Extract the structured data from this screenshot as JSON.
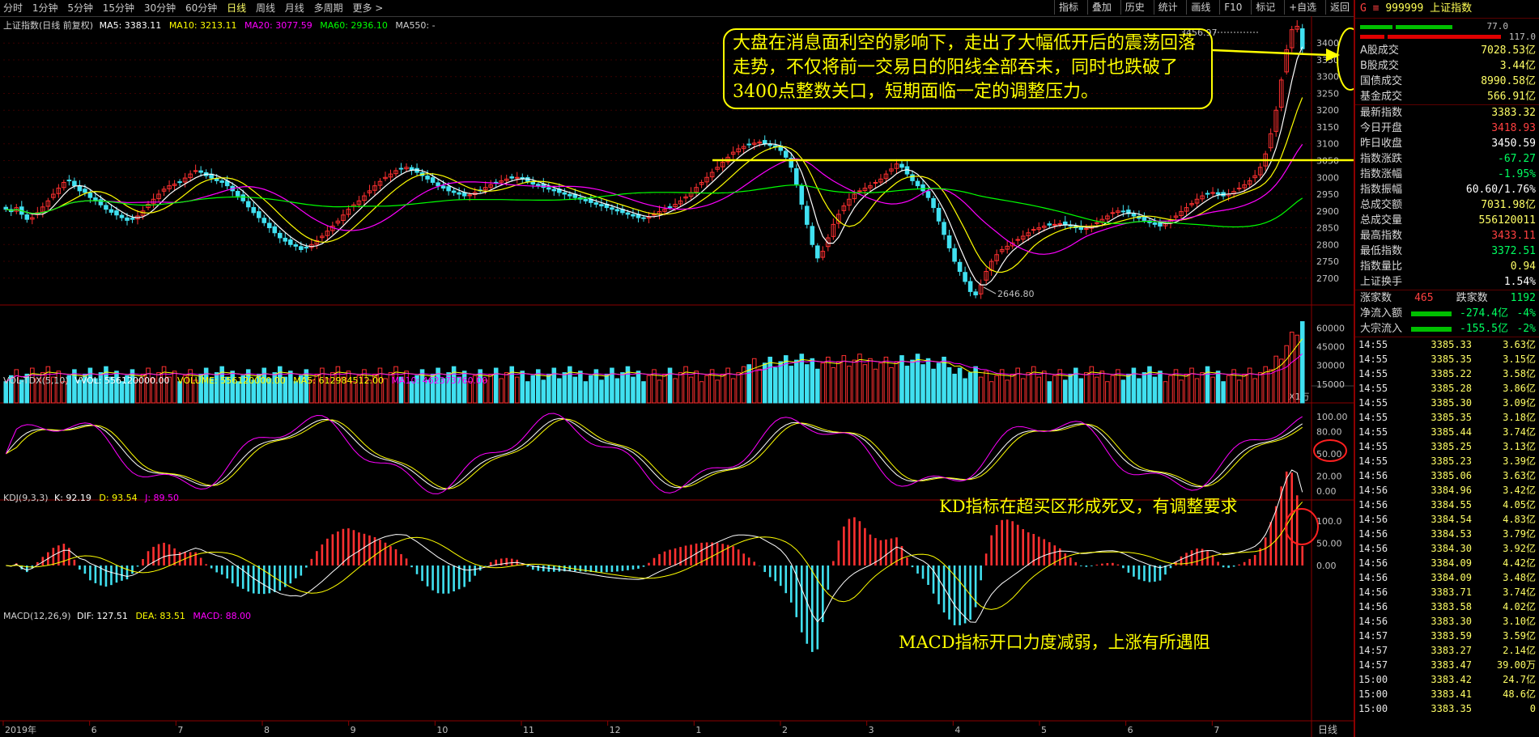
{
  "topbar": {
    "periods": [
      "分时",
      "1分钟",
      "5分钟",
      "15分钟",
      "30分钟",
      "60分钟",
      "日线",
      "周线",
      "月线",
      "多周期",
      "更多 >"
    ],
    "active_period": "日线",
    "right_buttons": [
      "指标",
      "叠加",
      "历史",
      "统计",
      "画线",
      "F10",
      "标记",
      "+自选",
      "返回"
    ]
  },
  "main_chart": {
    "title": "上证指数(日线 前复权)",
    "ma5": "MA5: 3383.11",
    "ma10": "MA10: 3213.11",
    "ma20": "MA20: 3077.59",
    "ma60": "MA60: 2936.10",
    "ma550": "MA550: -",
    "high_label": "3456.97",
    "low_label": "2646.80",
    "y_ticks": [
      "3400",
      "3350",
      "3300",
      "3250",
      "3200",
      "3150",
      "3100",
      "3050",
      "3000",
      "2950",
      "2900",
      "2850",
      "2800",
      "2750",
      "2700"
    ]
  },
  "volume_panel": {
    "title": "VOL-TDX(5,10)",
    "vvol": "VVOL: 556120000.00",
    "volume": "VOLUME: 556120000.00",
    "ma5": "MA5: 612984512.00",
    "ma10": "MA10: 462373760.00",
    "y_ticks": [
      "60000",
      "45000",
      "30000",
      "15000"
    ],
    "unit": "X1万"
  },
  "kdj_panel": {
    "title": "KDJ(9,3,3)",
    "k": "K: 92.19",
    "d": "D: 93.54",
    "j": "J: 89.50",
    "y_ticks": [
      "100.00",
      "80.00",
      "50.00",
      "20.00",
      "0.00"
    ]
  },
  "macd_panel": {
    "title": "MACD(12,26,9)",
    "dif": "DIF: 127.51",
    "dea": "DEA: 83.51",
    "macd": "MACD: 88.00",
    "y_ticks": [
      "100.0",
      "50.00",
      "0.00"
    ]
  },
  "x_axis": {
    "labels": [
      "2019年",
      "6",
      "7",
      "8",
      "9",
      "10",
      "11",
      "12",
      "1",
      "2",
      "3",
      "4",
      "5",
      "6",
      "7"
    ],
    "period_tag": "日线"
  },
  "annotations": {
    "main": "大盘在消息面利空的影响下，走出了大幅低开后的震荡回落走势，不仅将前一交易日的阳线全部吞末，同时也跌破了3400点整数关口，短期面临一定的调整压力。",
    "kd": "KD指标在超买区形成死叉，有调整要求",
    "macd": "MACD指标开口力度减弱，上涨有所遇阻"
  },
  "colors": {
    "up": "#ff3030",
    "down": "#40e0f0",
    "ma5": "#ffffff",
    "ma10": "#ffff00",
    "ma20": "#ff00ff",
    "ma60": "#00ff00",
    "annotation": "#ffff00"
  },
  "sidebar": {
    "header_code": "999999 上证指数",
    "header_prefix": "G ≡",
    "bar1_value": "77.0",
    "bar2_value": "117.0",
    "stats": [
      {
        "label": "A股成交",
        "value": "7028.53亿",
        "color": "#ffff66"
      },
      {
        "label": "B股成交",
        "value": "3.44亿",
        "color": "#ffff66"
      },
      {
        "label": "国债成交",
        "value": "8990.58亿",
        "color": "#ffff66"
      },
      {
        "label": "基金成交",
        "value": "566.91亿",
        "color": "#ffff66"
      }
    ],
    "quote": [
      {
        "label": "最新指数",
        "value": "3383.32",
        "color": "#ffff66"
      },
      {
        "label": "今日开盘",
        "value": "3418.93",
        "color": "#ff4040"
      },
      {
        "label": "昨日收盘",
        "value": "3450.59",
        "color": "#ffffff"
      },
      {
        "label": "指数涨跌",
        "value": "-67.27",
        "color": "#00ff60"
      },
      {
        "label": "指数涨幅",
        "value": "-1.95%",
        "color": "#00ff60"
      },
      {
        "label": "指数振幅",
        "value": "60.60/1.76%",
        "color": "#ffffff"
      },
      {
        "label": "总成交额",
        "value": "7031.98亿",
        "color": "#ffff66"
      },
      {
        "label": "总成交量",
        "value": "556120011",
        "color": "#ffff66"
      },
      {
        "label": "最高指数",
        "value": "3433.11",
        "color": "#ff4040"
      },
      {
        "label": "最低指数",
        "value": "3372.51",
        "color": "#00ff60"
      },
      {
        "label": "指数量比",
        "value": "0.94",
        "color": "#ffff66"
      },
      {
        "label": "上证换手",
        "value": "1.54%",
        "color": "#ffffff"
      }
    ],
    "breadth": {
      "up_label": "涨家数",
      "up_value": "465",
      "down_label": "跌家数",
      "down_value": "1192"
    },
    "flows": [
      {
        "label": "净流入额",
        "value": "-274.4亿",
        "pct": "-4%"
      },
      {
        "label": "大宗流入",
        "value": "-155.5亿",
        "pct": "-2%"
      }
    ],
    "trades": [
      {
        "t": "14:55",
        "p": "3385.33",
        "v": "3.63亿"
      },
      {
        "t": "14:55",
        "p": "3385.35",
        "v": "3.15亿"
      },
      {
        "t": "14:55",
        "p": "3385.22",
        "v": "3.58亿"
      },
      {
        "t": "14:55",
        "p": "3385.28",
        "v": "3.86亿"
      },
      {
        "t": "14:55",
        "p": "3385.30",
        "v": "3.09亿"
      },
      {
        "t": "14:55",
        "p": "3385.35",
        "v": "3.18亿"
      },
      {
        "t": "14:55",
        "p": "3385.44",
        "v": "3.74亿"
      },
      {
        "t": "14:55",
        "p": "3385.25",
        "v": "3.13亿"
      },
      {
        "t": "14:55",
        "p": "3385.23",
        "v": "3.39亿"
      },
      {
        "t": "14:56",
        "p": "3385.06",
        "v": "3.63亿"
      },
      {
        "t": "14:56",
        "p": "3384.96",
        "v": "3.42亿"
      },
      {
        "t": "14:56",
        "p": "3384.55",
        "v": "4.05亿"
      },
      {
        "t": "14:56",
        "p": "3384.54",
        "v": "4.83亿"
      },
      {
        "t": "14:56",
        "p": "3384.53",
        "v": "3.79亿"
      },
      {
        "t": "14:56",
        "p": "3384.30",
        "v": "3.92亿"
      },
      {
        "t": "14:56",
        "p": "3384.09",
        "v": "4.42亿"
      },
      {
        "t": "14:56",
        "p": "3384.09",
        "v": "3.48亿"
      },
      {
        "t": "14:56",
        "p": "3383.71",
        "v": "3.74亿"
      },
      {
        "t": "14:56",
        "p": "3383.58",
        "v": "4.02亿"
      },
      {
        "t": "14:56",
        "p": "3383.30",
        "v": "3.10亿"
      },
      {
        "t": "14:57",
        "p": "3383.59",
        "v": "3.59亿"
      },
      {
        "t": "14:57",
        "p": "3383.27",
        "v": "2.14亿"
      },
      {
        "t": "14:57",
        "p": "3383.47",
        "v": "39.00万"
      },
      {
        "t": "15:00",
        "p": "3383.42",
        "v": "24.7亿"
      },
      {
        "t": "15:00",
        "p": "3383.41",
        "v": "48.6亿"
      },
      {
        "t": "15:00",
        "p": "3383.35",
        "v": "0"
      }
    ]
  },
  "candle_series": [
    2905,
    2898,
    2910,
    2890,
    2875,
    2880,
    2895,
    2912,
    2930,
    2950,
    2968,
    2985,
    2990,
    2975,
    2960,
    2955,
    2940,
    2930,
    2918,
    2905,
    2896,
    2888,
    2880,
    2872,
    2875,
    2885,
    2900,
    2920,
    2935,
    2950,
    2965,
    2975,
    2980,
    2985,
    2998,
    3010,
    3020,
    3015,
    3005,
    2998,
    2990,
    2985,
    2975,
    2960,
    2945,
    2930,
    2912,
    2895,
    2880,
    2865,
    2850,
    2835,
    2820,
    2810,
    2800,
    2795,
    2785,
    2790,
    2800,
    2812,
    2825,
    2840,
    2855,
    2870,
    2888,
    2905,
    2918,
    2930,
    2945,
    2960,
    2975,
    2988,
    3000,
    3010,
    3020,
    3025,
    3030,
    3022,
    3015,
    3005,
    2995,
    2985,
    2975,
    2968,
    2960,
    2955,
    2950,
    2945,
    2948,
    2955,
    2962,
    2970,
    2978,
    2985,
    2990,
    2995,
    2998,
    3000,
    2995,
    2988,
    2980,
    2975,
    2970,
    2965,
    2960,
    2955,
    2950,
    2945,
    2940,
    2935,
    2930,
    2925,
    2920,
    2915,
    2910,
    2905,
    2900,
    2895,
    2890,
    2885,
    2880,
    2878,
    2882,
    2890,
    2898,
    2905,
    2912,
    2920,
    2930,
    2942,
    2955,
    2970,
    2985,
    3000,
    3015,
    3030,
    3045,
    3060,
    3075,
    3085,
    3092,
    3098,
    3102,
    3105,
    3100,
    3095,
    3090,
    3080,
    3060,
    3030,
    2980,
    2920,
    2860,
    2800,
    2760,
    2780,
    2820,
    2860,
    2890,
    2915,
    2935,
    2950,
    2960,
    2968,
    2975,
    2985,
    2995,
    3010,
    3025,
    3040,
    3030,
    3010,
    2990,
    2975,
    2960,
    2940,
    2910,
    2870,
    2830,
    2790,
    2750,
    2720,
    2690,
    2660,
    2650,
    2680,
    2720,
    2750,
    2770,
    2785,
    2795,
    2805,
    2815,
    2825,
    2835,
    2845,
    2850,
    2855,
    2858,
    2860,
    2862,
    2858,
    2855,
    2850,
    2845,
    2848,
    2855,
    2865,
    2875,
    2885,
    2895,
    2900,
    2898,
    2892,
    2885,
    2878,
    2872,
    2865,
    2860,
    2855,
    2862,
    2872,
    2885,
    2898,
    2910,
    2922,
    2935,
    2945,
    2952,
    2955,
    2950,
    2945,
    2950,
    2958,
    2968,
    2978,
    2990,
    3005,
    3030,
    3070,
    3130,
    3200,
    3290,
    3380,
    3440,
    3450,
    3383
  ]
}
